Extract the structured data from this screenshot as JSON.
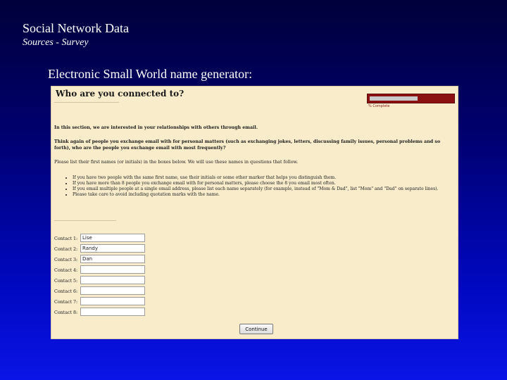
{
  "slide": {
    "title": "Social Network Data",
    "subtitle": "Sources - Survey",
    "heading": "Electronic Small World name generator:"
  },
  "form": {
    "title": "Who are you connected to?",
    "progress": {
      "label": "% Complete",
      "fraction": 0.58
    },
    "intro": "In this section, we are interested in your relationships with others through email.",
    "question": "Think again of people you exchange email with for personal matters (such as exchanging jokes, letters, discussing family issues, personal problems and so forth), who are the people you exchange email with most frequently?",
    "instruction": "Please list their first names (or initials) in the boxes below. We will use these names in questions that follow.",
    "bullets": [
      "If you have two people with the same first name, use their initials or some other marker that helps you distinguish them.",
      "If you have more than 8 people you exchange email with for personal matters, please choose the 8 you email most often.",
      "If you email multiple people at a single email address, please list each name separately (for example, instead of \"Mom & Dad\", list \"Mom\" and \"Dad\" on separate lines).",
      "Please take care to avoid including quotation marks with the name."
    ],
    "contacts": [
      {
        "label": "Contact 1:",
        "value": "Lise"
      },
      {
        "label": "Contact 2:",
        "value": "Randy"
      },
      {
        "label": "Contact 3:",
        "value": "Dan"
      },
      {
        "label": "Contact 4:",
        "value": ""
      },
      {
        "label": "Contact 5:",
        "value": ""
      },
      {
        "label": "Contact 6:",
        "value": ""
      },
      {
        "label": "Contact 7:",
        "value": ""
      },
      {
        "label": "Contact 8:",
        "value": ""
      }
    ],
    "continue_label": "Continue"
  }
}
